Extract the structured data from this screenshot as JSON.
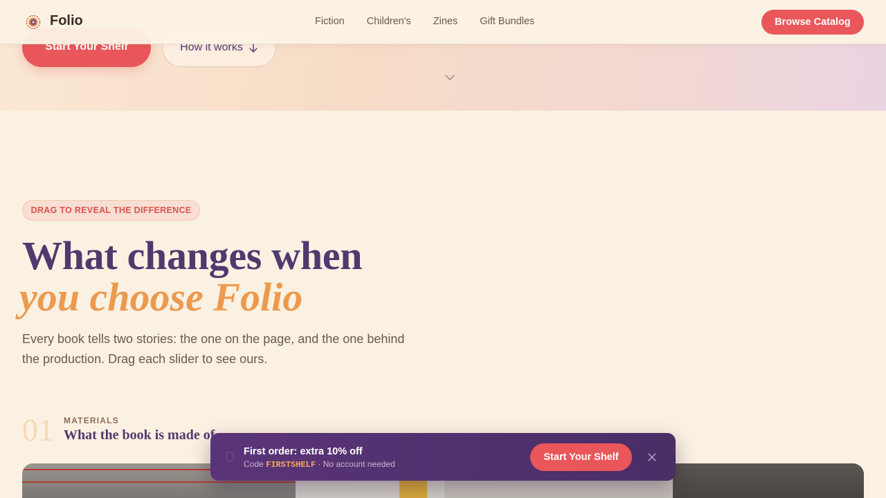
{
  "brand": {
    "name": "Folio",
    "logo_icon": "flower-logo-icon"
  },
  "nav": {
    "links": [
      "Fiction",
      "Children's",
      "Zines",
      "Gift Bundles"
    ],
    "cta_label": "Browse Catalog"
  },
  "hero": {
    "primary_label": "Start Your Shelf",
    "secondary_label": "How it works",
    "secondary_icon": "arrow-down-icon",
    "scroll_icon": "chevron-down-icon"
  },
  "section": {
    "tag": "DRAG TO REVEAL THE DIFFERENCE",
    "heading_line1": "What changes when",
    "heading_line2": "you choose Folio",
    "lead": "Every book tells two stories: the one on the page, and the one behind the production. Drag each slider to see ours."
  },
  "feature": {
    "number": "01",
    "kicker": "MATERIALS",
    "title": "What the book is made of"
  },
  "toast": {
    "title": "First order: extra 10% off",
    "code_prefix": "Code ",
    "code": "FIRSTSHELF",
    "code_suffix": " · No account needed",
    "cta_label": "Start Your Shelf",
    "icon": "book-icon",
    "close_icon": "close-icon"
  },
  "colors": {
    "accent": "#e9575a",
    "purple": "#4f3a6e",
    "orange": "#ec9a4e",
    "background": "#fbf1e2"
  }
}
